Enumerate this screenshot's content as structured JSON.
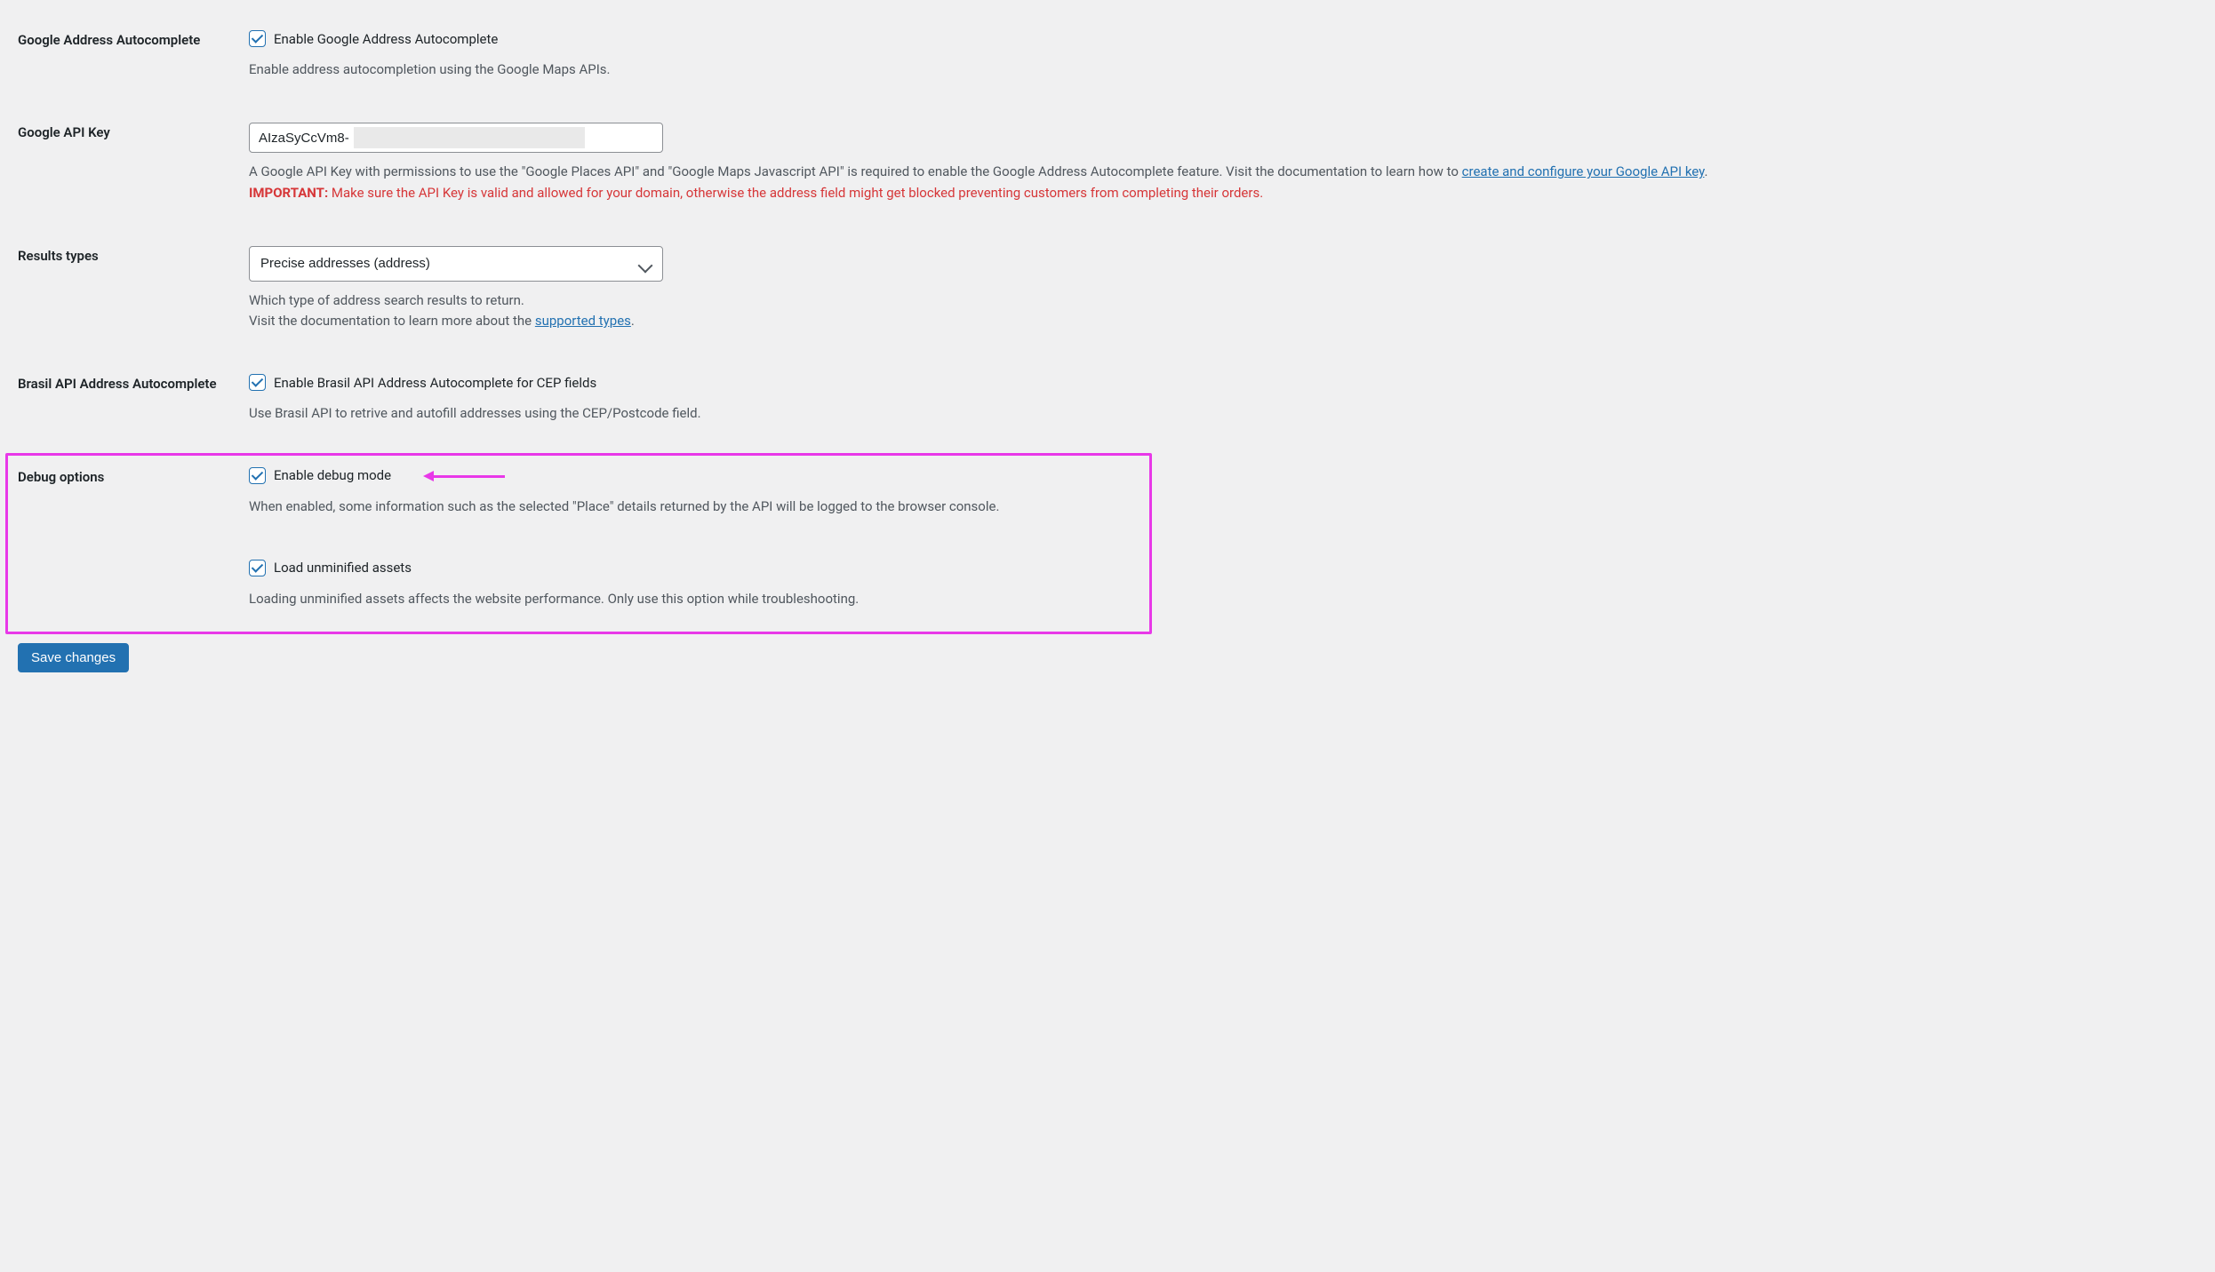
{
  "fields": {
    "google_autocomplete": {
      "label": "Google Address Autocomplete",
      "checkbox_label": "Enable Google Address Autocomplete",
      "checked": true,
      "description": "Enable address autocompletion using the Google Maps APIs."
    },
    "google_api_key": {
      "label": "Google API Key",
      "value": "AIzaSyCcVm8-",
      "description_pre": "A Google API Key with permissions to use the \"Google Places API\" and \"Google Maps Javascript API\" is required to enable the Google Address Autocomplete feature. Visit the documentation to learn how to ",
      "link_text": "create and configure your Google API key",
      "description_post": ".",
      "important_label": "IMPORTANT:",
      "important_text": " Make sure the API Key is valid and allowed for your domain, otherwise the address field might get blocked preventing customers from completing their orders."
    },
    "results_types": {
      "label": "Results types",
      "selected": "Precise addresses (address)",
      "description_pre": "Which type of address search results to return.",
      "description_line2_pre": "Visit the documentation to learn more about the ",
      "link_text": "supported types",
      "description_line2_post": "."
    },
    "brasil_api": {
      "label": "Brasil API Address Autocomplete",
      "checkbox_label": "Enable Brasil API Address Autocomplete for CEP fields",
      "checked": true,
      "description": "Use Brasil API to retrive and autofill addresses using the CEP/Postcode field."
    },
    "debug_options": {
      "label": "Debug options",
      "debug_mode": {
        "checkbox_label": "Enable debug mode",
        "checked": true,
        "description": "When enabled, some information such as the selected \"Place\" details returned by the API will be logged to the browser console."
      },
      "unminified": {
        "checkbox_label": "Load unminified assets",
        "checked": true,
        "description": "Loading unminified assets affects the website performance. Only use this option while troubleshooting."
      }
    }
  },
  "submit": {
    "label": "Save changes"
  }
}
